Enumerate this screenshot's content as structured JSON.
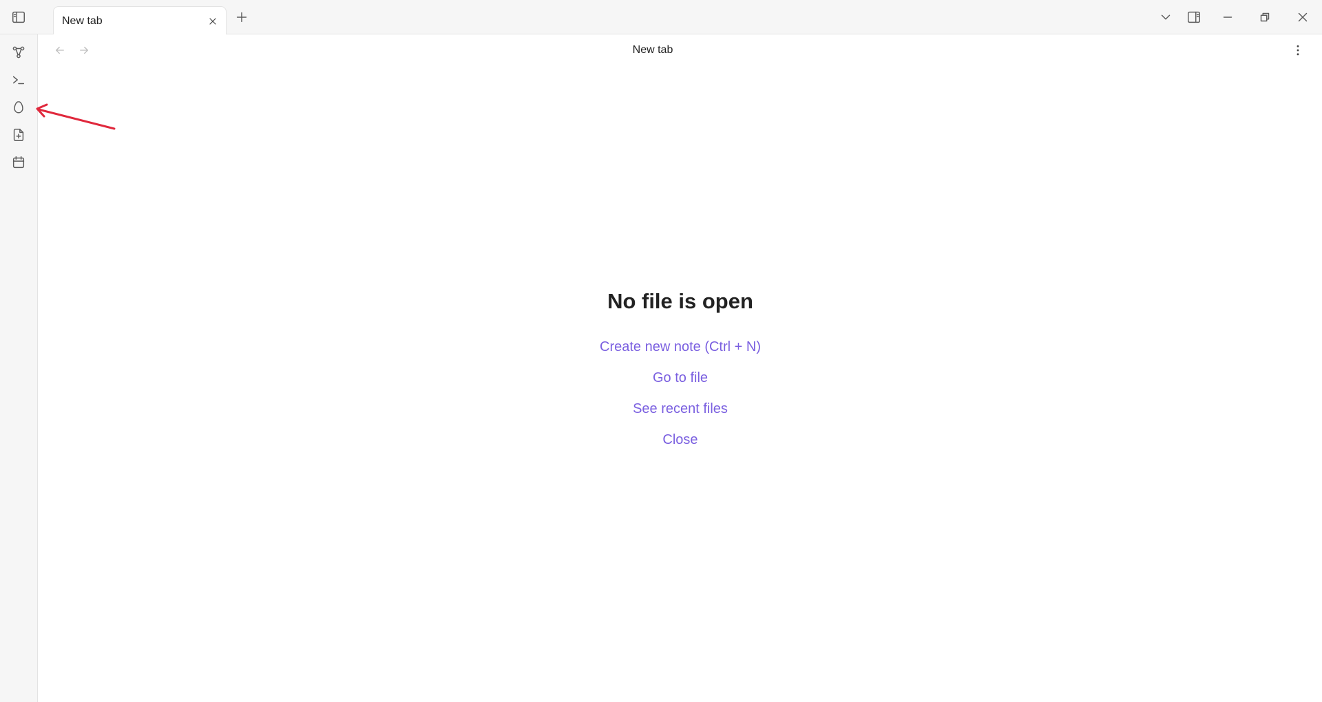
{
  "titlebar": {
    "tab": {
      "title": "New tab"
    }
  },
  "view": {
    "title": "New tab"
  },
  "empty_state": {
    "title": "No file is open",
    "actions": [
      {
        "label": "Create new note (Ctrl + N)"
      },
      {
        "label": "Go to file"
      },
      {
        "label": "See recent files"
      },
      {
        "label": "Close"
      }
    ]
  },
  "colors": {
    "accent": "#7a5fe0",
    "annotation_arrow": "#e0283c"
  },
  "icons": {
    "titlebar": [
      "sidebar-toggle-icon",
      "close-icon",
      "plus-icon",
      "chevron-down-icon",
      "right-sidebar-icon",
      "minimize-icon",
      "restore-icon",
      "close-window-icon"
    ],
    "ribbon": [
      "graph-view-icon",
      "terminal-icon",
      "egg-icon",
      "new-file-icon",
      "calendar-icon"
    ],
    "nav": [
      "arrow-left-icon",
      "arrow-right-icon",
      "more-options-icon"
    ]
  }
}
